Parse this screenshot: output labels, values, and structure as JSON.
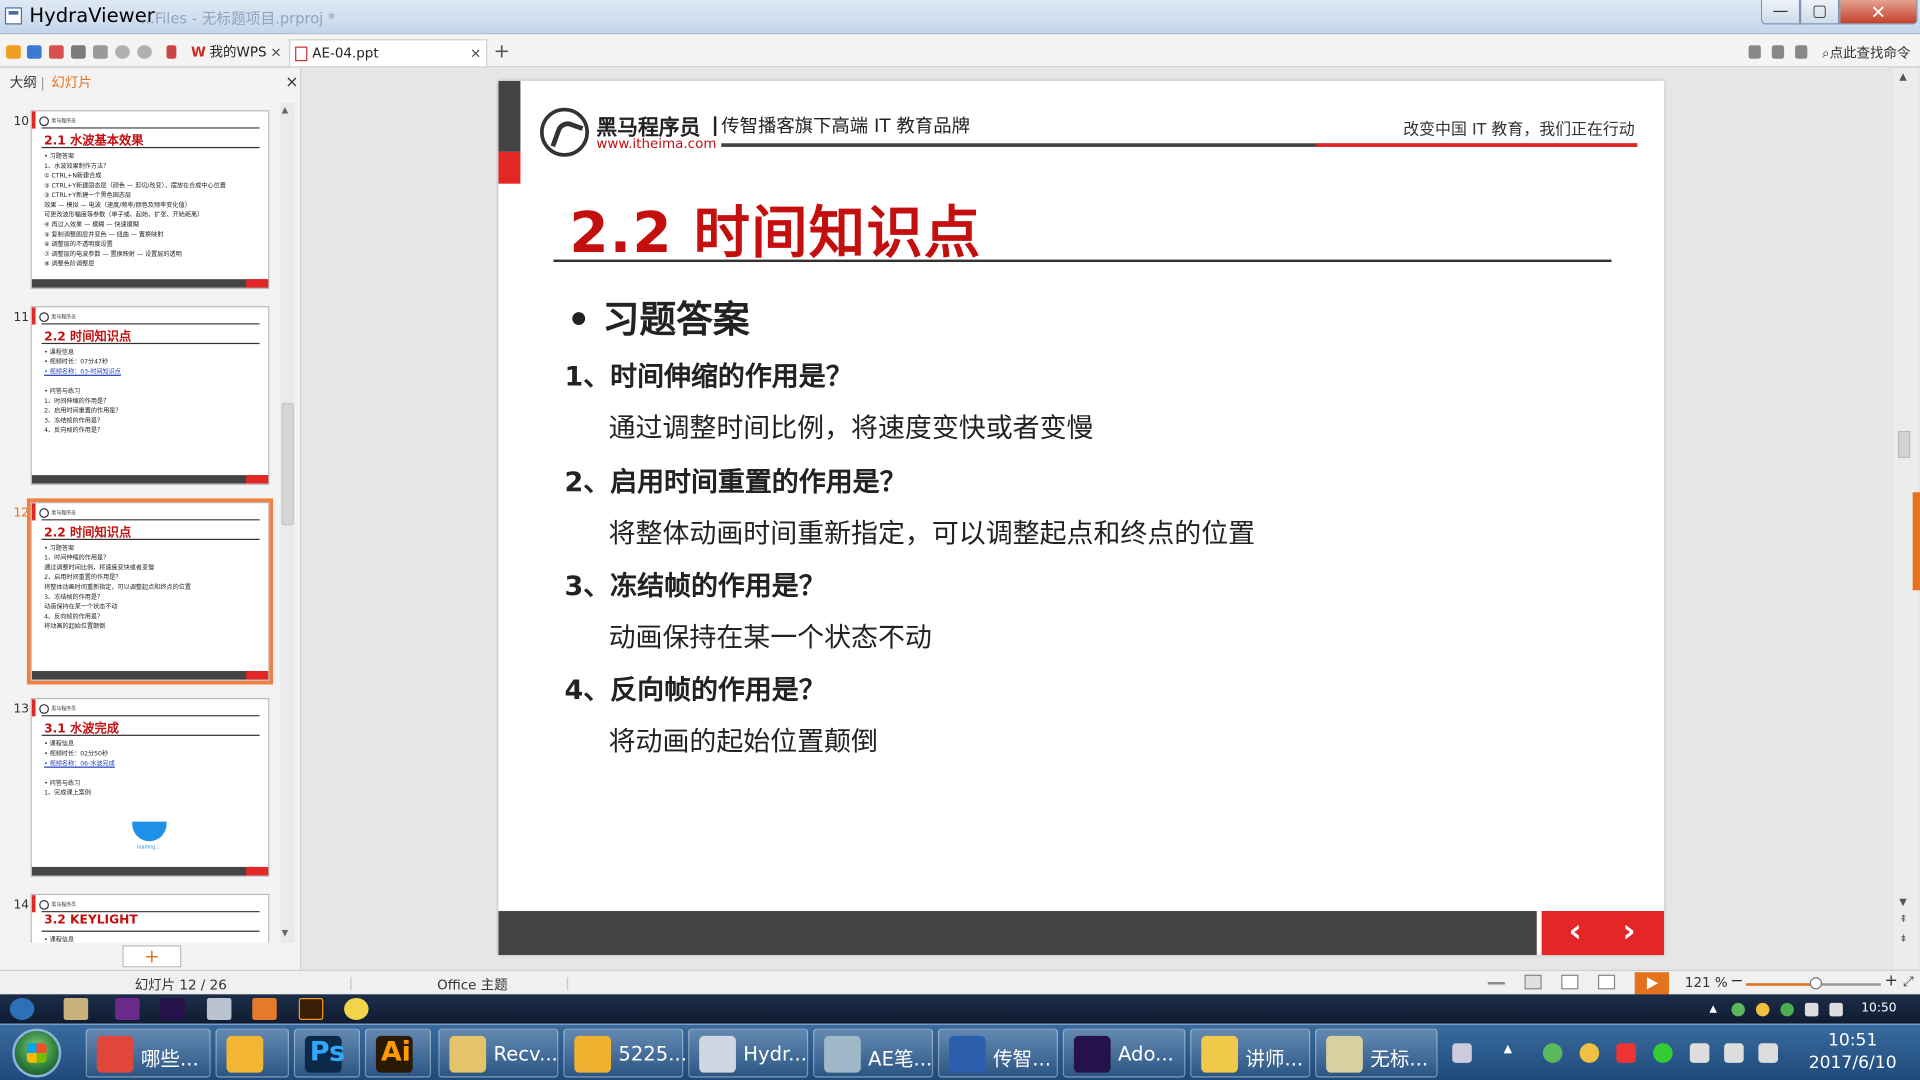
{
  "window": {
    "title": "HydraViewer",
    "ghost_title": "...Files - 无标题项目.prproj *",
    "min": "—",
    "max": "▢",
    "close": "✕"
  },
  "toolbar": {
    "tab_wps": "我的WPS",
    "tab_doc": "AE-04.ppt",
    "tab_close": "×",
    "tab_add": "+",
    "search_cmd": "点此查找命令"
  },
  "left_panel": {
    "outline_tab": "大纲",
    "separator": "|",
    "slides_tab": "幻灯片",
    "close": "×",
    "add_slide": "+",
    "thumbnails": [
      {
        "num": "10",
        "title": "2.1 水波基本效果",
        "lines": [
          "• 习题答案",
          "1、水波效果制作方法？",
          "  ① CTRL+N新建合成",
          "  ② CTRL+Y新建固态层（颜色 — 剪切/改变），摆放在合成中心位置",
          "  ③ CTRL+Y新建一个黑色固态层",
          "     效果 — 模拟 — 电波（速度/频率/颜色及频率变化值）",
          "     可更改波形幅度等参数（单子或、起始、扩张、开始距离）",
          "  ④ 再过入效果 — 模糊 — 快速模糊",
          "  ⑤ 复制调整图层并变色 — 扭曲 — 置换映射",
          "  ⑥ 调整层的不透明度设置",
          "  ⑦ 调整层的电波参数 — 置换映射 — 设置层的透明",
          "  ⑧ 调整色阶调整层"
        ]
      },
      {
        "num": "11",
        "title": "2.2 时间知识点",
        "lines": [
          "• 课程信息",
          "• 视频时长：07分47秒",
          "• 视频名称：03-时间知识点",
          "",
          "• 问答与练习",
          "1、时间伸缩的作用是？",
          "2、启用时间重置的作用是？",
          "3、冻结帧的作用是？",
          "4、反向帧的作用是？"
        ],
        "link_line": 2
      },
      {
        "num": "12",
        "title": "2.2 时间知识点",
        "lines": [
          "• 习题答案",
          "1、时间伸缩的作用是？",
          "   通过调整时间比例，将速度变快或者变慢",
          "2、启用时间重置的作用是？",
          "   将整体动画时间重新指定，可以调整起点和终点的位置",
          "3、冻结帧的作用是？",
          "   动画保持在某一个状态不动",
          "4、反向帧的作用是？",
          "   将动画的起始位置颠倒"
        ]
      },
      {
        "num": "13",
        "title": "3.1 水波完成",
        "lines": [
          "• 课程信息",
          "• 视频时长：02分50秒",
          "• 视频名称：06-水波完成",
          "",
          "• 问答与练习",
          "1、完成课上案例"
        ],
        "link_line": 2,
        "blob_caption": "loading..."
      },
      {
        "num": "14",
        "title": "3.2 KEYLIGHT",
        "lines": [
          "• 课程信息"
        ]
      }
    ]
  },
  "slide": {
    "brand": "黑马程序员",
    "url": "www.itheima.com",
    "slogan": "传智播客旗下高端 IT 教育品牌",
    "tagline": "改变中国 IT 教育，我们正在行动",
    "title": "2.2 时间知识点",
    "bullet": "习题答案",
    "qa": [
      {
        "q": "1、时间伸缩的作用是？",
        "a": "通过调整时间比例，将速度变快或者变慢"
      },
      {
        "q": "2、启用时间重置的作用是？",
        "a": "将整体动画时间重新指定，可以调整起点和终点的位置"
      },
      {
        "q": "3、冻结帧的作用是？",
        "a": "动画保持在某一个状态不动"
      },
      {
        "q": "4、反向帧的作用是？",
        "a": "将动画的起始位置颠倒"
      }
    ],
    "prev": "‹",
    "next": "›"
  },
  "status": {
    "slide_counter": "幻灯片 12 / 26",
    "theme": "Office 主题",
    "zoom": "121 %",
    "zoom_minus": "−",
    "zoom_plus": "+",
    "zoom_fraction": 0.47
  },
  "quick_clock": "10:50",
  "taskbar": {
    "items": [
      {
        "label": "哪些...",
        "color": "#e0463a"
      },
      {
        "label": "",
        "color": "#f2b632"
      },
      {
        "label": "Ps",
        "color": "#0c2a47"
      },
      {
        "label": "Ai",
        "color": "#2a1a05"
      },
      {
        "label": "Recv...",
        "color": "#e3c46a"
      },
      {
        "label": "5225...",
        "color": "#f0b030"
      },
      {
        "label": "Hydr...",
        "color": "#cfd8e2"
      },
      {
        "label": "AE笔...",
        "color": "#9fb8c8"
      },
      {
        "label": "传智...",
        "color": "#2b5fae"
      },
      {
        "label": "Ado...",
        "color": "#25124a"
      },
      {
        "label": "讲师...",
        "color": "#f0c84a"
      },
      {
        "label": "无标...",
        "color": "#d8d0a0"
      }
    ],
    "time": "10:51",
    "date": "2017/6/10"
  },
  "colors": {
    "accent_orange": "#e6721d",
    "brand_red": "#c40f0f",
    "slide_dark": "#444444"
  }
}
